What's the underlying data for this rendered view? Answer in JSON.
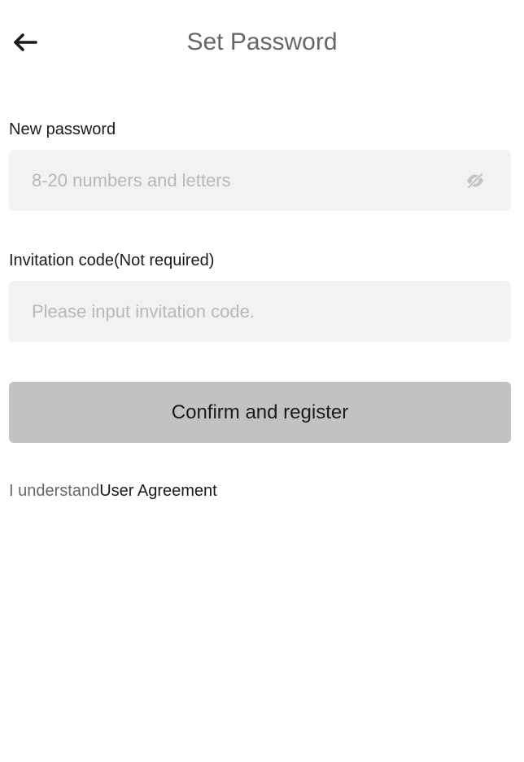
{
  "header": {
    "title": "Set Password",
    "back_icon": "arrow-left-icon"
  },
  "form": {
    "password": {
      "label": "New password",
      "placeholder": "8-20 numbers and letters",
      "value": "",
      "toggle_icon": "eye-off-icon"
    },
    "invitation": {
      "label": "Invitation code(Not required)",
      "placeholder": "Please input invitation code.",
      "value": ""
    },
    "submit_label": "Confirm and register"
  },
  "agreement": {
    "prefix": "I understand",
    "link_text": "User Agreement"
  },
  "colors": {
    "title": "#666666",
    "field_bg": "#f2f2f2",
    "placeholder": "#b8b8b8",
    "button_bg": "#c2c2c2",
    "text": "#1a1a1a"
  }
}
